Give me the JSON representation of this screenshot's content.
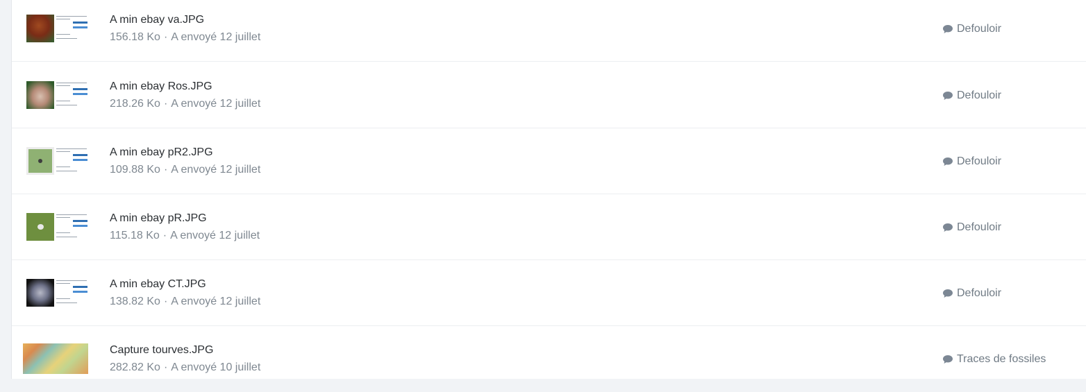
{
  "files": [
    {
      "name": "A min ebay va.JPG",
      "size": "156.18 Ko",
      "sent": "A envoyé 12 juillet",
      "forum": "Defouloir",
      "thumb": "photo-va",
      "forum_icon": "chat-icon"
    },
    {
      "name": "A min ebay Ros.JPG",
      "size": "218.26 Ko",
      "sent": "A envoyé 12 juillet",
      "forum": "Defouloir",
      "thumb": "photo-ros",
      "forum_icon": "chat-icon"
    },
    {
      "name": "A min ebay pR2.JPG",
      "size": "109.88 Ko",
      "sent": "A envoyé 12 juillet",
      "forum": "Defouloir",
      "thumb": "photo-pr2",
      "forum_icon": "chat-icon"
    },
    {
      "name": "A min ebay pR.JPG",
      "size": "115.18 Ko",
      "sent": "A envoyé 12 juillet",
      "forum": "Defouloir",
      "thumb": "photo-pr",
      "forum_icon": "chat-icon"
    },
    {
      "name": "A min ebay CT.JPG",
      "size": "138.82 Ko",
      "sent": "A envoyé 12 juillet",
      "forum": "Defouloir",
      "thumb": "photo-ct",
      "forum_icon": "chat-icon"
    },
    {
      "name": "Capture tourves.JPG",
      "size": "282.82 Ko",
      "sent": "A envoyé 10 juillet",
      "forum": "Traces de fossiles",
      "thumb": "map",
      "forum_icon": "chat-icon"
    }
  ],
  "separator": "·",
  "colors": {
    "title": "#2b2f33",
    "meta": "#7f8891",
    "forum": "#6f7a84",
    "background": "#f1f3f6"
  }
}
